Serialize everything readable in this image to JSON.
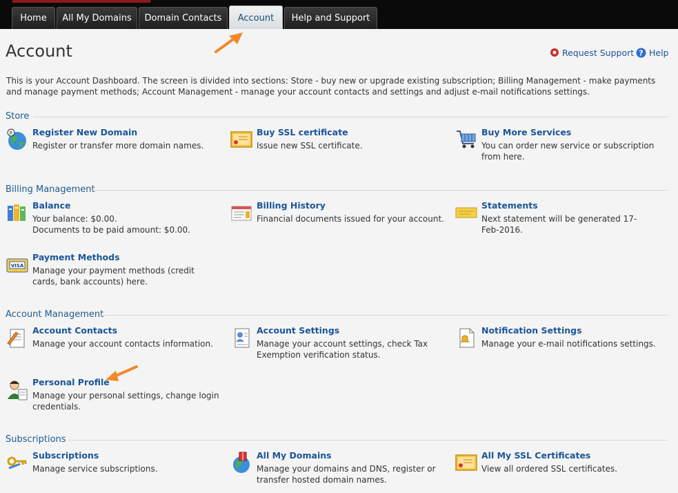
{
  "nav": {
    "tabs": [
      {
        "label": "Home"
      },
      {
        "label": "All My Domains"
      },
      {
        "label": "Domain Contacts"
      },
      {
        "label": "Account"
      },
      {
        "label": "Help and Support"
      }
    ]
  },
  "header": {
    "title": "Account",
    "request_support": "Request Support",
    "help": "Help"
  },
  "intro": "This is your Account Dashboard. The screen is divided into sections: Store - buy new or upgrade existing subscription; Billing Management - make payments and manage payment methods; Account Management - manage your account contacts and settings and adjust e-mail notifications settings.",
  "sections": [
    {
      "title": "Store",
      "items": [
        {
          "title": "Register New Domain",
          "desc": "Register or transfer more domain names."
        },
        {
          "title": "Buy SSL certificate",
          "desc": "Issue new SSL certificate."
        },
        {
          "title": "Buy More Services",
          "desc": "You can order new service or subscription from here."
        }
      ]
    },
    {
      "title": "Billing Management",
      "items": [
        {
          "title": "Balance",
          "desc": "Your balance: $0.00.",
          "desc2": "Documents to be paid amount: $0.00."
        },
        {
          "title": "Billing History",
          "desc": "Financial documents issued for your account."
        },
        {
          "title": "Statements",
          "desc": "Next statement will be generated 17-Feb-2016."
        },
        {
          "title": "Payment Methods",
          "desc": "Manage your payment methods (credit cards, bank accounts) here."
        }
      ]
    },
    {
      "title": "Account Management",
      "items": [
        {
          "title": "Account Contacts",
          "desc": "Manage your account contacts information."
        },
        {
          "title": "Account Settings",
          "desc": "Manage your account settings, check Tax Exemption verification status."
        },
        {
          "title": "Notification Settings",
          "desc": "Manage your e-mail notifications settings."
        },
        {
          "title": "Personal Profile",
          "desc": "Manage your personal settings, change login credentials."
        }
      ]
    },
    {
      "title": "Subscriptions",
      "items": [
        {
          "title": "Subscriptions",
          "desc": "Manage service subscriptions."
        },
        {
          "title": "All My Domains",
          "desc": "Manage your domains and DNS, register or transfer hosted domain names."
        },
        {
          "title": "All My SSL Certificates",
          "desc": "View all ordered SSL certificates."
        }
      ]
    }
  ],
  "colors": {
    "link": "#1a5599",
    "section_title": "#1d5c8f",
    "annotation_arrow": "#f0892a",
    "topbar": "#0a0a0a"
  }
}
